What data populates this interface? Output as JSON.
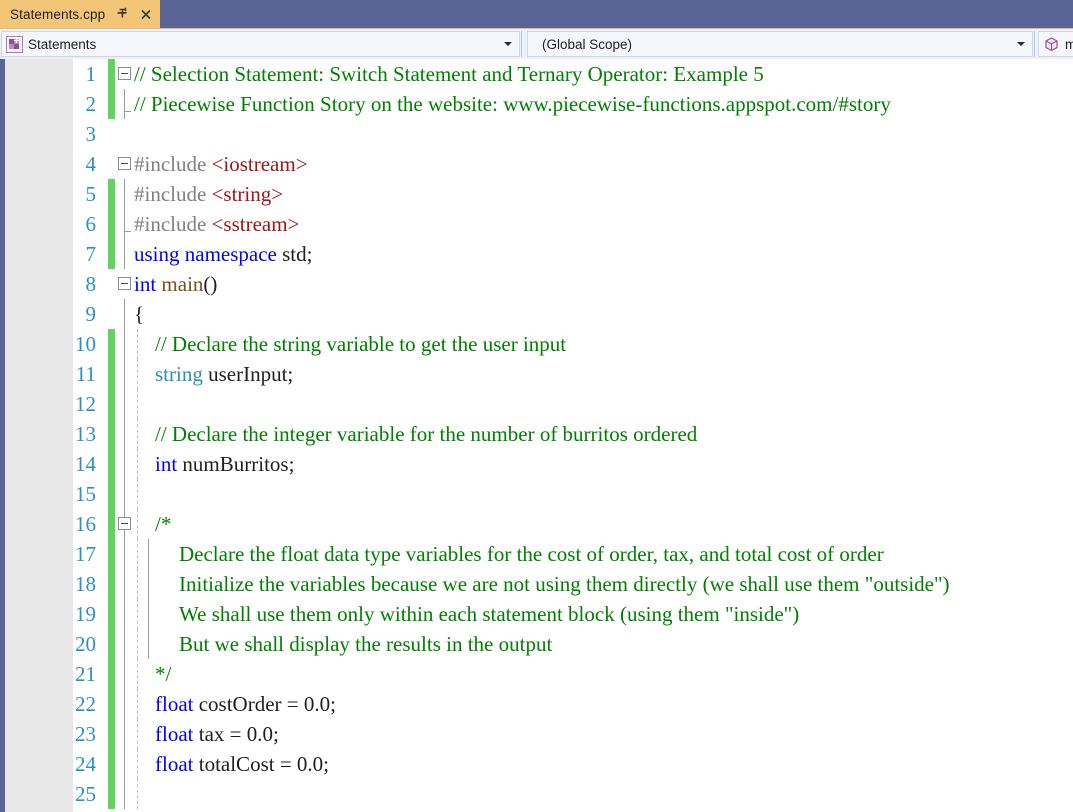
{
  "window": {
    "tab": {
      "title": "Statements.cpp",
      "pin_icon": "pin-icon",
      "close_icon": "close-icon"
    },
    "accent_color": "#5b6595",
    "tab_color": "#f3c577"
  },
  "navbar": {
    "project_combo": {
      "icon": "project-icon",
      "value": "Statements",
      "arrow_icon": "chevron-down-icon"
    },
    "scope_combo": {
      "value": "(Global Scope)",
      "arrow_icon": "chevron-down-icon"
    },
    "member_combo": {
      "icon": "member-cube-icon",
      "value": "m"
    }
  },
  "editor": {
    "line_number_color": "#2b91c4",
    "change_marker_color": "#62d363",
    "lines": [
      {
        "n": "1",
        "indent": 0,
        "changed": true,
        "fold": "open",
        "text": "// Selection Statement: Switch Statement and Ternary Operator: Example 5",
        "cls": "cm"
      },
      {
        "n": "2",
        "indent": 0,
        "changed": true,
        "fold": "none",
        "text": "// Piecewise Function Story on the website: www.piecewise-functions.appspot.com/#story",
        "cls": "cm"
      },
      {
        "n": "3",
        "indent": 0,
        "changed": false,
        "fold": "none",
        "text": "",
        "cls": "pl"
      },
      {
        "n": "4",
        "indent": 0,
        "changed": false,
        "fold": "open",
        "text": "#include <iostream>",
        "cls": "pp"
      },
      {
        "n": "5",
        "indent": 0,
        "changed": true,
        "fold": "none",
        "text": "#include <string>",
        "cls": "pp"
      },
      {
        "n": "6",
        "indent": 0,
        "changed": true,
        "fold": "none",
        "text": "#include <sstream>",
        "cls": "pp"
      },
      {
        "n": "7",
        "indent": 0,
        "changed": true,
        "fold": "none",
        "text": "using namespace std;",
        "cls": "kw"
      },
      {
        "n": "8",
        "indent": 0,
        "changed": false,
        "fold": "open",
        "text": "int main()",
        "cls": "kw"
      },
      {
        "n": "9",
        "indent": 0,
        "changed": false,
        "fold": "none",
        "text": "{",
        "cls": "pl"
      },
      {
        "n": "10",
        "indent": 1,
        "changed": true,
        "fold": "none",
        "text": "// Declare the string variable to get the user input",
        "cls": "cm"
      },
      {
        "n": "11",
        "indent": 1,
        "changed": true,
        "fold": "none",
        "text": "string userInput;",
        "cls": "type"
      },
      {
        "n": "12",
        "indent": 1,
        "changed": true,
        "fold": "none",
        "text": "",
        "cls": "pl"
      },
      {
        "n": "13",
        "indent": 1,
        "changed": true,
        "fold": "none",
        "text": "// Declare the integer variable for the number of burritos ordered",
        "cls": "cm"
      },
      {
        "n": "14",
        "indent": 1,
        "changed": true,
        "fold": "none",
        "text": "int numBurritos;",
        "cls": "kw"
      },
      {
        "n": "15",
        "indent": 1,
        "changed": true,
        "fold": "none",
        "text": "",
        "cls": "pl"
      },
      {
        "n": "16",
        "indent": 1,
        "changed": true,
        "fold": "open",
        "text": "/*",
        "cls": "cm"
      },
      {
        "n": "17",
        "indent": 2,
        "changed": true,
        "fold": "none",
        "text": "Declare the float data type variables for the cost of order, tax, and total cost of order",
        "cls": "cm"
      },
      {
        "n": "18",
        "indent": 2,
        "changed": true,
        "fold": "none",
        "text": "Initialize the variables because we are not using them directly (we shall use them \"outside\")",
        "cls": "cm"
      },
      {
        "n": "19",
        "indent": 2,
        "changed": true,
        "fold": "none",
        "text": "We shall use them only within each statement block (using them \"inside\")",
        "cls": "cm"
      },
      {
        "n": "20",
        "indent": 2,
        "changed": true,
        "fold": "none",
        "text": "But we shall display the results in the output",
        "cls": "cm"
      },
      {
        "n": "21",
        "indent": 1,
        "changed": true,
        "fold": "none",
        "text": "*/",
        "cls": "cm"
      },
      {
        "n": "22",
        "indent": 1,
        "changed": true,
        "fold": "none",
        "text": "float costOrder = 0.0;",
        "cls": "kw"
      },
      {
        "n": "23",
        "indent": 1,
        "changed": true,
        "fold": "none",
        "text": "float tax = 0.0;",
        "cls": "kw"
      },
      {
        "n": "24",
        "indent": 1,
        "changed": true,
        "fold": "none",
        "text": "float totalCost = 0.0;",
        "cls": "kw"
      },
      {
        "n": "25",
        "indent": 1,
        "changed": true,
        "fold": "none",
        "text": "",
        "cls": "pl"
      }
    ],
    "tokens": {
      "1": [
        [
          "cm",
          "// Selection Statement: Switch Statement and Ternary Operator: Example 5"
        ]
      ],
      "2": [
        [
          "cm",
          "// Piecewise Function Story on the website: www.piecewise-functions.appspot.com/#story"
        ]
      ],
      "4": [
        [
          "pp",
          "#include "
        ],
        [
          "str",
          "<iostream>"
        ]
      ],
      "5": [
        [
          "pp",
          "#include "
        ],
        [
          "str",
          "<string>"
        ]
      ],
      "6": [
        [
          "pp",
          "#include "
        ],
        [
          "str",
          "<sstream>"
        ]
      ],
      "7": [
        [
          "kw",
          "using namespace "
        ],
        [
          "pl",
          "std;"
        ]
      ],
      "8": [
        [
          "kw",
          "int "
        ],
        [
          "fn",
          "main"
        ],
        [
          "pl",
          "()"
        ]
      ],
      "9": [
        [
          "pl",
          "{"
        ]
      ],
      "10": [
        [
          "cm",
          "// Declare the string variable to get the user input"
        ]
      ],
      "11": [
        [
          "type",
          "string "
        ],
        [
          "pl",
          "userInput;"
        ]
      ],
      "13": [
        [
          "cm",
          "// Declare the integer variable for the number of burritos ordered"
        ]
      ],
      "14": [
        [
          "kw",
          "int "
        ],
        [
          "pl",
          "numBurritos;"
        ]
      ],
      "16": [
        [
          "cm",
          "/*"
        ]
      ],
      "17": [
        [
          "cm",
          "Declare the float data type variables for the cost of order, tax, and total cost of order"
        ]
      ],
      "18": [
        [
          "cm",
          "Initialize the variables because we are not using them directly (we shall use them \"outside\")"
        ]
      ],
      "19": [
        [
          "cm",
          "We shall use them only within each statement block (using them \"inside\")"
        ]
      ],
      "20": [
        [
          "cm",
          "But we shall display the results in the output"
        ]
      ],
      "21": [
        [
          "cm",
          "*/"
        ]
      ],
      "22": [
        [
          "kw",
          "float "
        ],
        [
          "pl",
          "costOrder = 0.0;"
        ]
      ],
      "23": [
        [
          "kw",
          "float "
        ],
        [
          "pl",
          "tax = 0.0;"
        ]
      ],
      "24": [
        [
          "kw",
          "float "
        ],
        [
          "pl",
          "totalCost = 0.0;"
        ]
      ]
    }
  }
}
